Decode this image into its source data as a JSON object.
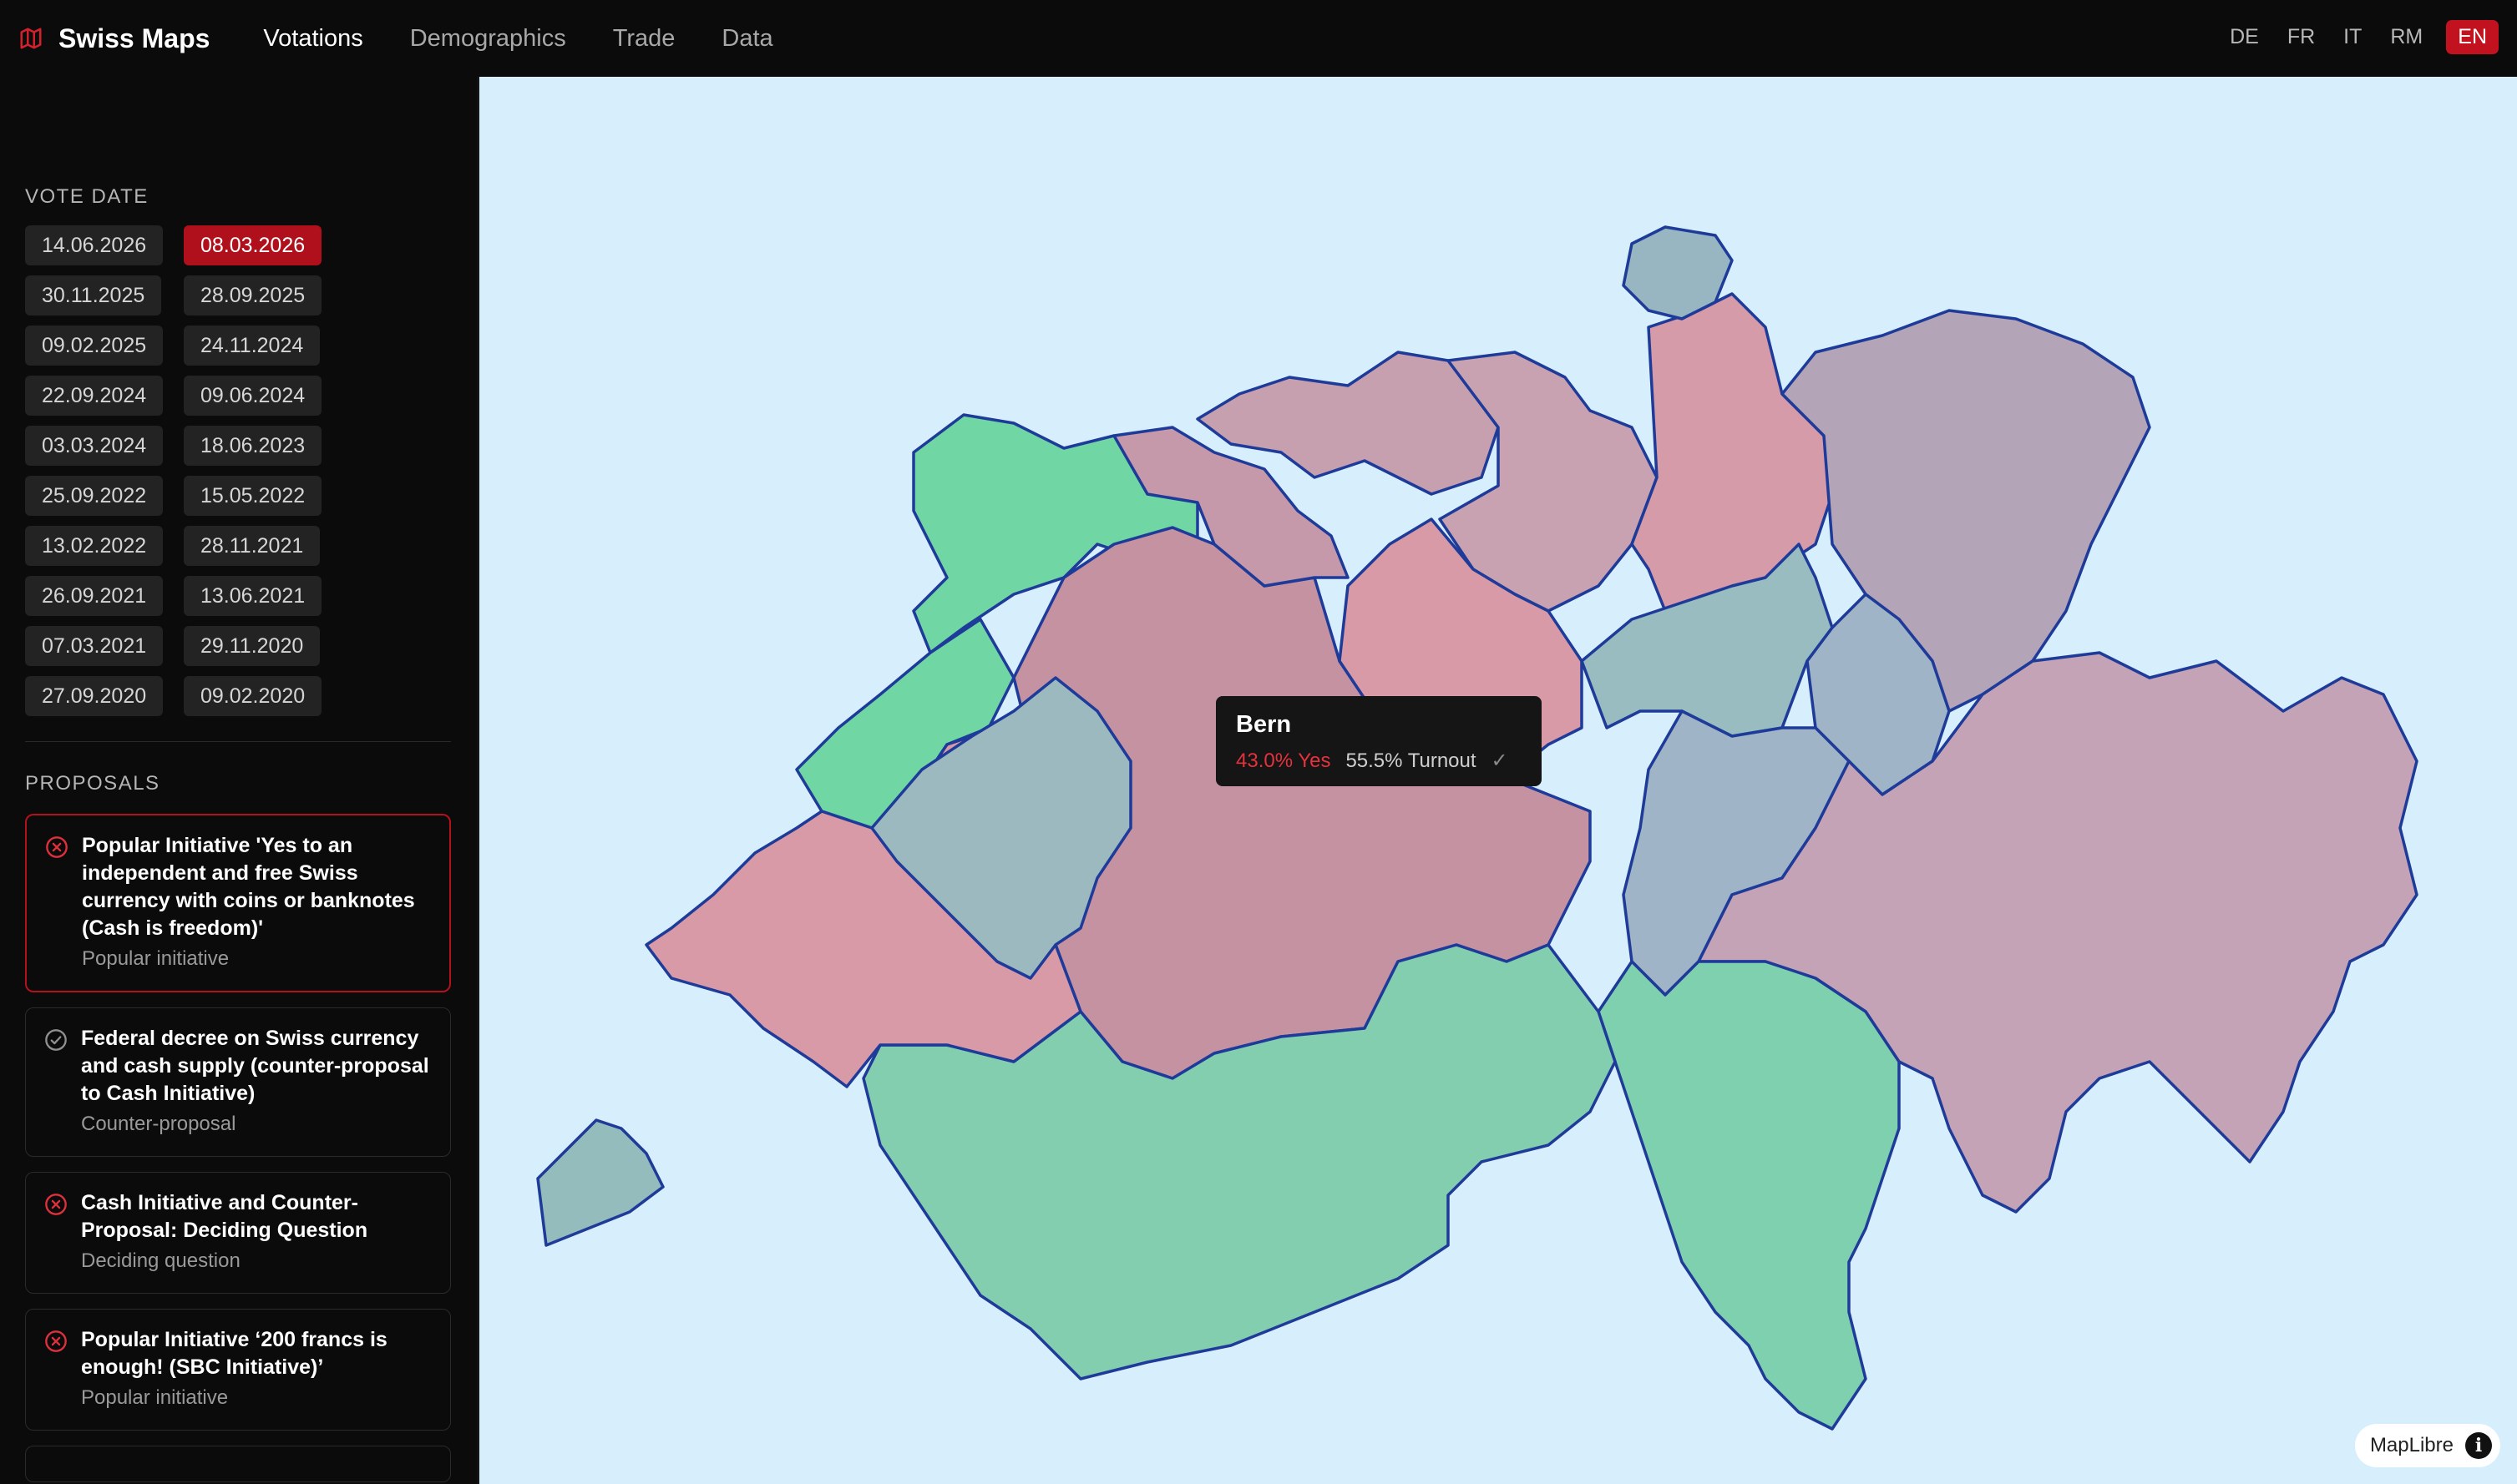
{
  "app": {
    "name": "Swiss Maps",
    "icon": "map-icon"
  },
  "nav": [
    {
      "label": "Votations",
      "active": true
    },
    {
      "label": "Demographics",
      "active": false
    },
    {
      "label": "Trade",
      "active": false
    },
    {
      "label": "Data",
      "active": false
    }
  ],
  "languages": [
    {
      "label": "DE",
      "active": false
    },
    {
      "label": "FR",
      "active": false
    },
    {
      "label": "IT",
      "active": false
    },
    {
      "label": "RM",
      "active": false
    },
    {
      "label": "EN",
      "active": true
    }
  ],
  "sidebar": {
    "vote_date_title": "VOTE DATE",
    "dates": [
      {
        "label": "14.06.2026",
        "active": false
      },
      {
        "label": "08.03.2026",
        "active": true
      },
      {
        "label": "30.11.2025",
        "active": false
      },
      {
        "label": "28.09.2025",
        "active": false
      },
      {
        "label": "09.02.2025",
        "active": false
      },
      {
        "label": "24.11.2024",
        "active": false
      },
      {
        "label": "22.09.2024",
        "active": false
      },
      {
        "label": "09.06.2024",
        "active": false
      },
      {
        "label": "03.03.2024",
        "active": false
      },
      {
        "label": "18.06.2023",
        "active": false
      },
      {
        "label": "25.09.2022",
        "active": false
      },
      {
        "label": "15.05.2022",
        "active": false
      },
      {
        "label": "13.02.2022",
        "active": false
      },
      {
        "label": "28.11.2021",
        "active": false
      },
      {
        "label": "26.09.2021",
        "active": false
      },
      {
        "label": "13.06.2021",
        "active": false
      },
      {
        "label": "07.03.2021",
        "active": false
      },
      {
        "label": "29.11.2020",
        "active": false
      },
      {
        "label": "27.09.2020",
        "active": false
      },
      {
        "label": "09.02.2020",
        "active": false
      }
    ],
    "proposals_title": "PROPOSALS",
    "proposals": [
      {
        "title": "Popular Initiative 'Yes to an independent and free Swiss currency with coins or banknotes (Cash is freedom)'",
        "type": "Popular initiative",
        "result": "rejected",
        "active": true
      },
      {
        "title": "Federal decree on Swiss currency and cash supply (counter-proposal to Cash Initiative)",
        "type": "Counter-proposal",
        "result": "accepted",
        "active": false
      },
      {
        "title": "Cash Initiative and Counter-Proposal: Deciding Question",
        "type": "Deciding question",
        "result": "rejected",
        "active": false
      },
      {
        "title": "Popular Initiative ‘200 francs is enough! (SBC Initiative)’",
        "type": "Popular initiative",
        "result": "rejected",
        "active": false
      }
    ]
  },
  "colors": {
    "accent": "#c3121f",
    "yes_strong": "#6fd6a4",
    "yes": "#84ceb0",
    "neutral_blue": "#98b6c2",
    "neutral_purple": "#b3a4b8",
    "no": "#d89aa6",
    "no_mid": "#c99aa8",
    "border": "#1f3b9a",
    "map_bg": "#d7eefc"
  },
  "tooltip": {
    "canton": "Bern",
    "yes": "43.0% Yes",
    "turnout": "55.5% Turnout",
    "mark": "✓"
  },
  "attribution": {
    "label": "MapLibre",
    "info": "i"
  }
}
